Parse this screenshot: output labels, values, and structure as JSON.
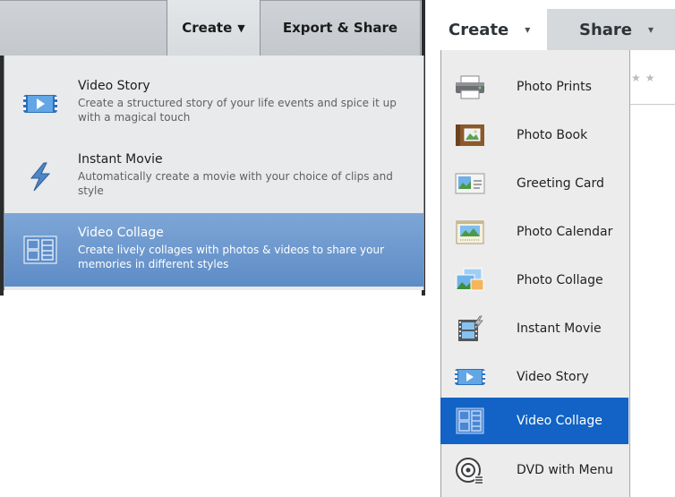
{
  "left": {
    "tabs": {
      "create": "Create",
      "export_share": "Export & Share"
    },
    "items": [
      {
        "title": "Video Story",
        "desc": "Create a structured story of your life events and spice it up with a magical touch",
        "icon": "video-story-icon"
      },
      {
        "title": "Instant Movie",
        "desc": "Automatically create a movie with your choice of clips and style",
        "icon": "lightning-icon"
      },
      {
        "title": "Video Collage",
        "desc": "Create lively collages with photos & videos to share your memories in different styles",
        "icon": "video-collage-icon",
        "selected": true
      }
    ]
  },
  "right": {
    "tabs": {
      "create": "Create",
      "share": "Share"
    },
    "items": [
      {
        "label": "Photo Prints",
        "icon": "printer-icon"
      },
      {
        "label": "Photo Book",
        "icon": "photo-book-icon"
      },
      {
        "label": "Greeting Card",
        "icon": "greeting-card-icon"
      },
      {
        "label": "Photo Calendar",
        "icon": "calendar-icon"
      },
      {
        "label": "Photo Collage",
        "icon": "photo-collage-icon"
      },
      {
        "label": "Instant Movie",
        "icon": "instant-movie-icon"
      },
      {
        "label": "Video Story",
        "icon": "video-story-icon"
      },
      {
        "label": "Video Collage",
        "icon": "video-collage-icon",
        "selected": true
      },
      {
        "label": "DVD with Menu",
        "icon": "dvd-icon"
      }
    ]
  },
  "colors": {
    "left_selected": "#6d97cd",
    "right_selected": "#1263c5"
  }
}
